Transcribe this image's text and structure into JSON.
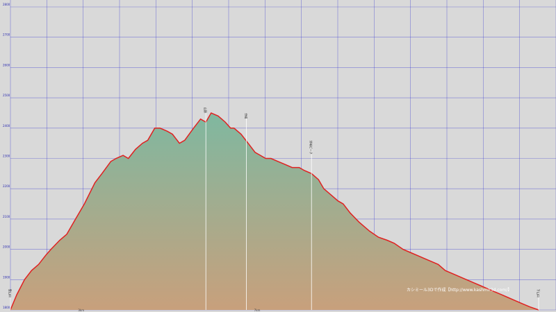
{
  "chart_data": {
    "type": "area",
    "title": "",
    "xlabel": "",
    "ylabel": "",
    "grid": true,
    "colors": {
      "background": "#d9d9d9",
      "grid": "#3030d0",
      "line": "#e02020",
      "fill_top": "#7fb8a0",
      "fill_bottom": "#c8a07c"
    },
    "ylim": [
      1800,
      2800
    ],
    "yticks": [
      1800,
      1900,
      2000,
      2100,
      2200,
      2300,
      2400,
      2500,
      2600,
      2700,
      2800
    ],
    "ytick_labels": [
      "1800",
      "1900",
      "2000",
      "2100",
      "2200",
      "2300",
      "2400",
      "2500",
      "2600",
      "2700",
      "2800"
    ],
    "xlim": [
      0,
      15
    ],
    "xticks": [
      1,
      2,
      3,
      4,
      5,
      6,
      7,
      8,
      9,
      10,
      11,
      12,
      13,
      14
    ],
    "xtick_labels": [
      "",
      "3km",
      "",
      "",
      "",
      "",
      "7km",
      "",
      "",
      "",
      "",
      "",
      "",
      ""
    ],
    "x": [
      0,
      0.18,
      0.4,
      0.6,
      0.8,
      1.0,
      1.15,
      1.4,
      1.6,
      1.85,
      2.1,
      2.4,
      2.6,
      2.85,
      3.0,
      3.2,
      3.35,
      3.55,
      3.75,
      3.9,
      4.1,
      4.25,
      4.45,
      4.6,
      4.8,
      4.95,
      5.2,
      5.4,
      5.55,
      5.7,
      5.9,
      6.1,
      6.25,
      6.35,
      6.55,
      6.75,
      6.95,
      7.1,
      7.25,
      7.4,
      7.6,
      7.8,
      8.0,
      8.2,
      8.35,
      8.55,
      8.75,
      8.9,
      9.1,
      9.3,
      9.45,
      9.65,
      9.9,
      10.2,
      10.45,
      10.7,
      10.9,
      11.15,
      11.35,
      11.55,
      11.75,
      11.95,
      12.15,
      12.35,
      12.55,
      12.75,
      12.95,
      13.15,
      13.35,
      13.55,
      13.75,
      13.95,
      14.15,
      14.35,
      14.55,
      14.75,
      15.0
    ],
    "y": [
      1800,
      1850,
      1900,
      1930,
      1950,
      1980,
      2000,
      2030,
      2050,
      2100,
      2150,
      2220,
      2250,
      2290,
      2300,
      2310,
      2300,
      2330,
      2350,
      2360,
      2400,
      2400,
      2390,
      2380,
      2350,
      2360,
      2400,
      2430,
      2420,
      2450,
      2440,
      2420,
      2400,
      2400,
      2380,
      2350,
      2320,
      2310,
      2300,
      2300,
      2290,
      2280,
      2270,
      2270,
      2260,
      2250,
      2230,
      2200,
      2180,
      2160,
      2150,
      2120,
      2090,
      2060,
      2040,
      2030,
      2020,
      2000,
      1990,
      1980,
      1970,
      1960,
      1950,
      1930,
      1920,
      1910,
      1900,
      1890,
      1880,
      1870,
      1860,
      1850,
      1840,
      1830,
      1820,
      1810,
      1800
    ],
    "annotations": [
      {
        "x": 0,
        "label": "登山口",
        "y_label_at": 1860
      },
      {
        "x": 5.55,
        "label": "山頂",
        "y_label_at": 2460
      },
      {
        "x": 6.7,
        "label": "分岐",
        "y_label_at": 2440
      },
      {
        "x": 8.55,
        "label": "分岐ピーク",
        "y_label_at": 2350
      },
      {
        "x": 15.0,
        "label": "下山口",
        "y_label_at": 1860
      }
    ],
    "credit": "カシミール3Dで作成【http://www.kashmir3d.com/】"
  }
}
